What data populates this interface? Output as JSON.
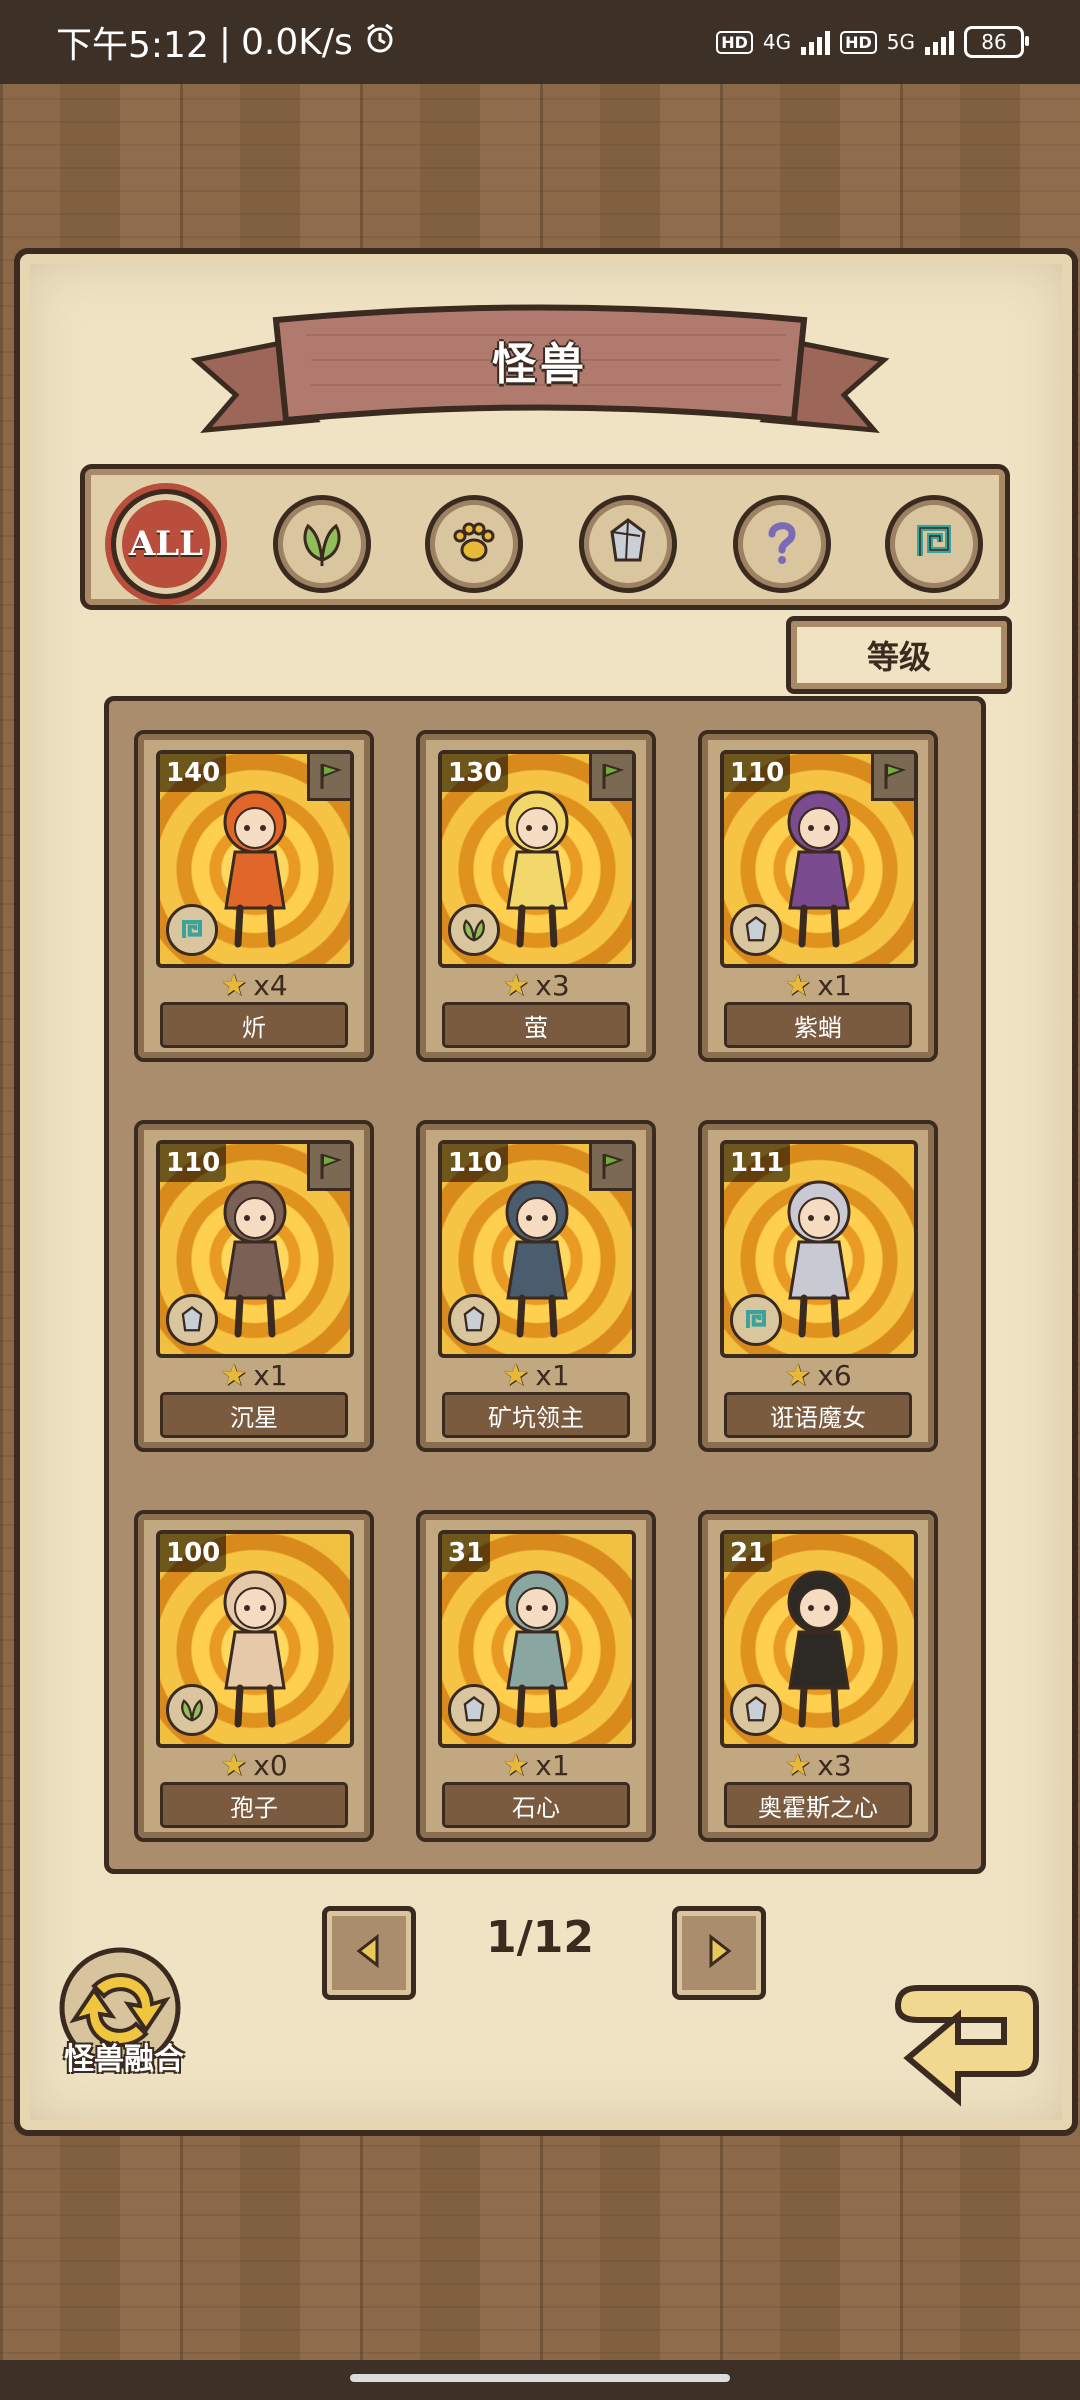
{
  "status_bar": {
    "time": "下午5:12",
    "speed": "0.0K/s",
    "net1": "4G",
    "net2": "5G",
    "hd": "HD",
    "battery": "86"
  },
  "header": {
    "title": "怪兽"
  },
  "filters": [
    {
      "label": "ALL",
      "icon": "all-icon",
      "active": true
    },
    {
      "label": "",
      "icon": "leaf-icon"
    },
    {
      "label": "",
      "icon": "paw-icon"
    },
    {
      "label": "",
      "icon": "crystal-icon"
    },
    {
      "label": "",
      "icon": "question-icon"
    },
    {
      "label": "",
      "icon": "spiral-icon"
    }
  ],
  "sort": {
    "label": "等级"
  },
  "monsters": [
    {
      "level": "140",
      "count": "x4",
      "name": "炘",
      "type_icon": "spiral-icon",
      "flag": true
    },
    {
      "level": "130",
      "count": "x3",
      "name": "萤",
      "type_icon": "leaf-icon",
      "flag": true
    },
    {
      "level": "110",
      "count": "x1",
      "name": "紫蛸",
      "type_icon": "crystal-icon",
      "flag": true
    },
    {
      "level": "110",
      "count": "x1",
      "name": "沉星",
      "type_icon": "crystal-icon",
      "flag": true
    },
    {
      "level": "110",
      "count": "x1",
      "name": "矿坑领主",
      "type_icon": "crystal-icon",
      "flag": true
    },
    {
      "level": "111",
      "count": "x6",
      "name": "诳语魔女",
      "type_icon": "spiral-icon",
      "flag": false
    },
    {
      "level": "100",
      "count": "x0",
      "name": "孢子",
      "type_icon": "leaf-icon",
      "flag": false
    },
    {
      "level": "31",
      "count": "x1",
      "name": "石心",
      "type_icon": "crystal-icon",
      "flag": false
    },
    {
      "level": "21",
      "count": "x3",
      "name": "奥霍斯之心",
      "type_icon": "crystal-icon",
      "flag": false
    }
  ],
  "pager": {
    "page": "1/12"
  },
  "fusion": {
    "label": "怪兽融合"
  },
  "colors": {
    "paper": "#efe3c3",
    "ink": "#3a2a1f",
    "banner": "#b07a6e",
    "card_gold": "#f2c040"
  }
}
